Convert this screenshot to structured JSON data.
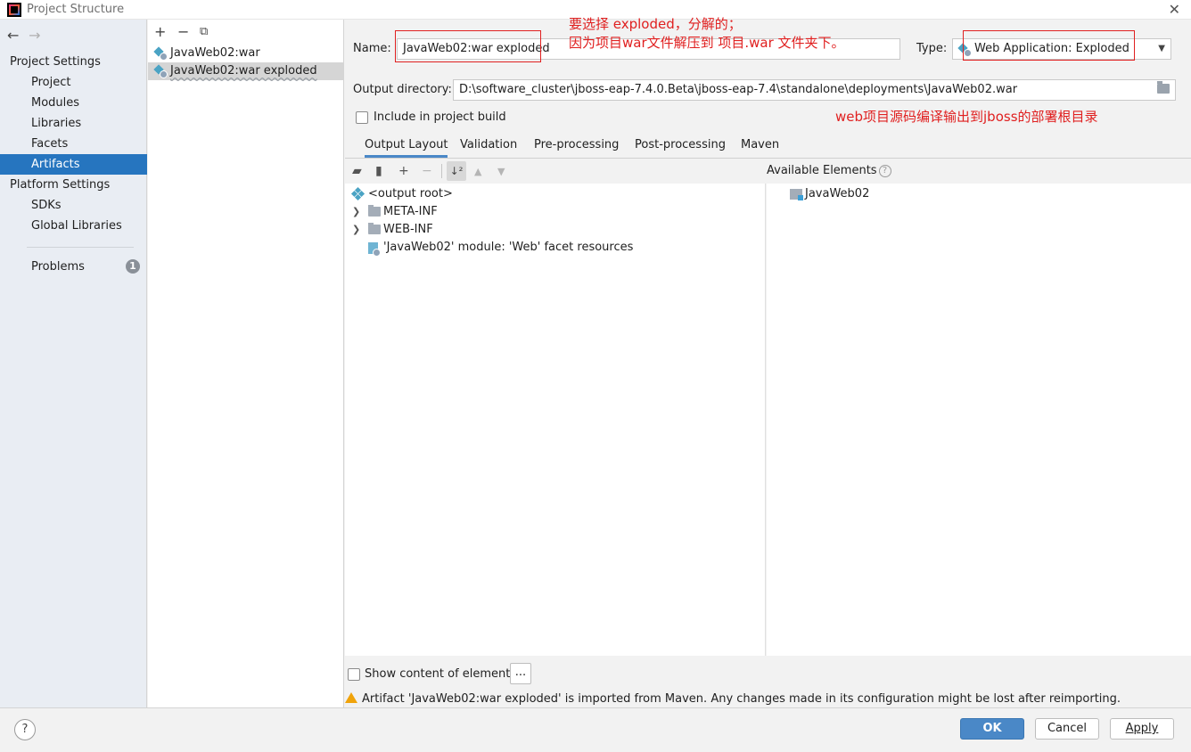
{
  "window": {
    "title": "Project Structure"
  },
  "nav": {
    "project_settings": "Project Settings",
    "project_items": [
      "Project",
      "Modules",
      "Libraries",
      "Facets",
      "Artifacts"
    ],
    "platform_settings": "Platform Settings",
    "platform_items": [
      "SDKs",
      "Global Libraries"
    ],
    "problems": "Problems",
    "problems_count": "1",
    "selected": "Artifacts"
  },
  "artifacts": {
    "items": [
      "JavaWeb02:war",
      "JavaWeb02:war exploded"
    ],
    "selected": "JavaWeb02:war exploded"
  },
  "form": {
    "name_label": "Name:",
    "name_value": "JavaWeb02:war exploded",
    "type_label": "Type:",
    "type_value": "Web Application: Exploded",
    "output_label": "Output directory:",
    "output_value": "D:\\software_cluster\\jboss-eap-7.4.0.Beta\\jboss-eap-7.4\\standalone\\deployments\\JavaWeb02.war",
    "include_build_label": "Include in project build",
    "include_build_checked": false
  },
  "annotations": {
    "line1": "要选择 exploded，分解的；",
    "line2": "因为项目war文件解压到 项目.war 文件夹下。",
    "line3": "web项目源码编译输出到jboss的部署根目录"
  },
  "tabs": [
    "Output Layout",
    "Validation",
    "Pre-processing",
    "Post-processing",
    "Maven"
  ],
  "active_tab": "Output Layout",
  "tree": {
    "root": "<output root>",
    "items": [
      "META-INF",
      "WEB-INF"
    ],
    "resource": "'JavaWeb02' module: 'Web' facet resources"
  },
  "available": {
    "header": "Available Elements",
    "items": [
      "JavaWeb02"
    ]
  },
  "show_content_label": "Show content of elements",
  "dots_label": "...",
  "warning": "Artifact 'JavaWeb02:war exploded' is imported from Maven. Any changes made in its configuration might be lost after reimporting.",
  "buttons": {
    "ok": "OK",
    "cancel": "Cancel",
    "apply": "Apply",
    "help": "?"
  },
  "colors": {
    "accent": "#2675bf",
    "annotation": "#e02020",
    "warning": "#f0a30a"
  }
}
